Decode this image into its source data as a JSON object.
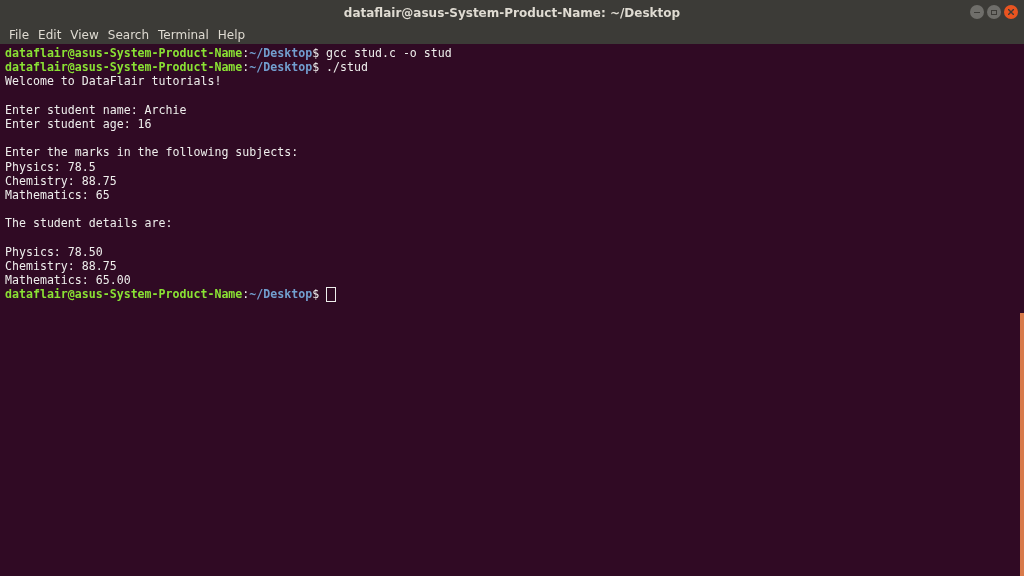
{
  "window": {
    "title": "dataflair@asus-System-Product-Name: ~/Desktop"
  },
  "menu": [
    "File",
    "Edit",
    "View",
    "Search",
    "Terminal",
    "Help"
  ],
  "terminal": {
    "lines": [
      {
        "kind": "prompt",
        "user": "dataflair@asus-System-Product-Name",
        "separator": ":",
        "path": "~/Desktop",
        "sign": "$",
        "command": "gcc stud.c -o stud",
        "cursor": false
      },
      {
        "kind": "prompt",
        "user": "dataflair@asus-System-Product-Name",
        "separator": ":",
        "path": "~/Desktop",
        "sign": "$",
        "command": "./stud",
        "cursor": false
      },
      {
        "kind": "output",
        "text": "Welcome to DataFlair tutorials!"
      },
      {
        "kind": "blank"
      },
      {
        "kind": "output",
        "text": "Enter student name: Archie"
      },
      {
        "kind": "output",
        "text": "Enter student age: 16"
      },
      {
        "kind": "blank"
      },
      {
        "kind": "output",
        "text": "Enter the marks in the following subjects:"
      },
      {
        "kind": "output",
        "text": "Physics: 78.5"
      },
      {
        "kind": "output",
        "text": "Chemistry: 88.75"
      },
      {
        "kind": "output",
        "text": "Mathematics: 65"
      },
      {
        "kind": "blank"
      },
      {
        "kind": "output",
        "text": "The student details are:"
      },
      {
        "kind": "blank"
      },
      {
        "kind": "output",
        "text": "Physics: 78.50"
      },
      {
        "kind": "output",
        "text": "Chemistry: 88.75"
      },
      {
        "kind": "output",
        "text": "Mathematics: 65.00"
      },
      {
        "kind": "prompt",
        "user": "dataflair@asus-System-Product-Name",
        "separator": ":",
        "path": "~/Desktop",
        "sign": "$",
        "cursor": true
      }
    ]
  }
}
